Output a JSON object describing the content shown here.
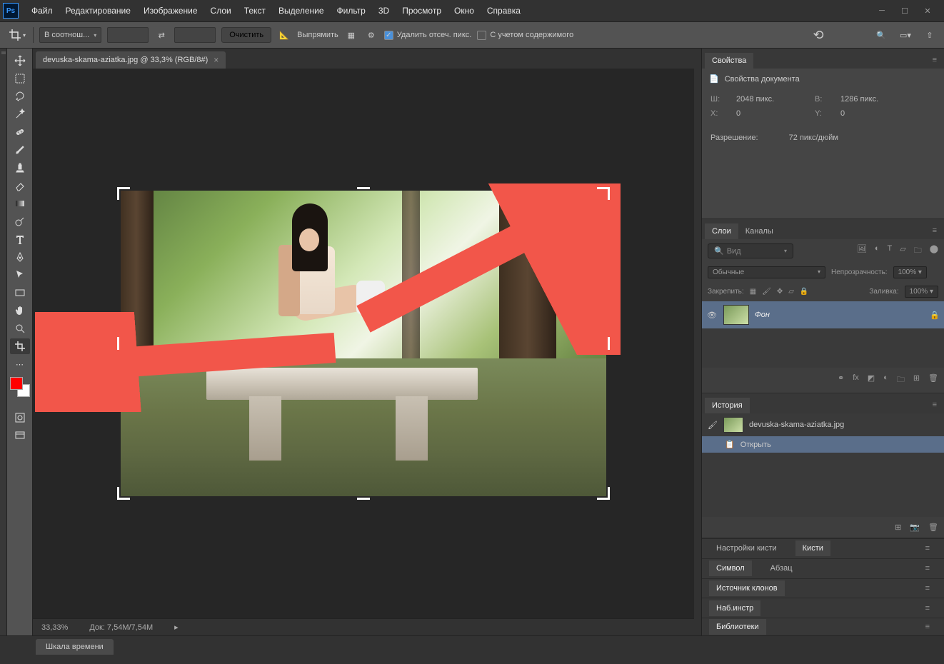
{
  "app": {
    "logo": "Ps"
  },
  "menu": [
    "Файл",
    "Редактирование",
    "Изображение",
    "Слои",
    "Текст",
    "Выделение",
    "Фильтр",
    "3D",
    "Просмотр",
    "Окно",
    "Справка"
  ],
  "options": {
    "ratio_label": "В соотнош...",
    "clear": "Очистить",
    "straighten": "Выпрямить",
    "delete_pixels": "Удалить отсеч. пикс.",
    "content_aware": "С учетом содержимого"
  },
  "document": {
    "tab": "devuska-skama-aziatka.jpg @ 33,3% (RGB/8#)",
    "zoom": "33,33%",
    "doc_size": "Док: 7,54M/7,54M"
  },
  "properties": {
    "title": "Свойства",
    "doc_props": "Свойства документа",
    "w_label": "Ш:",
    "w_val": "2048 пикс.",
    "h_label": "В:",
    "h_val": "1286 пикс.",
    "x_label": "X:",
    "x_val": "0",
    "y_label": "Y:",
    "y_val": "0",
    "res_label": "Разрешение:",
    "res_val": "72 пикс/дюйм"
  },
  "layers": {
    "tab1": "Слои",
    "tab2": "Каналы",
    "search": "Вид",
    "blend": "Обычные",
    "opacity_label": "Непрозрачность:",
    "opacity": "100%",
    "lock_label": "Закрепить:",
    "fill_label": "Заливка:",
    "fill": "100%",
    "layer_name": "Фон"
  },
  "history": {
    "title": "История",
    "snapshot": "devuska-skama-aziatka.jpg",
    "step1": "Открыть"
  },
  "panels": {
    "brush_settings": "Настройки кисти",
    "brushes": "Кисти",
    "character": "Символ",
    "paragraph": "Абзац",
    "clone_source": "Источник клонов",
    "tool_presets": "Наб.инстр",
    "libraries": "Библиотеки"
  },
  "bottom": {
    "timeline": "Шкала времени"
  }
}
